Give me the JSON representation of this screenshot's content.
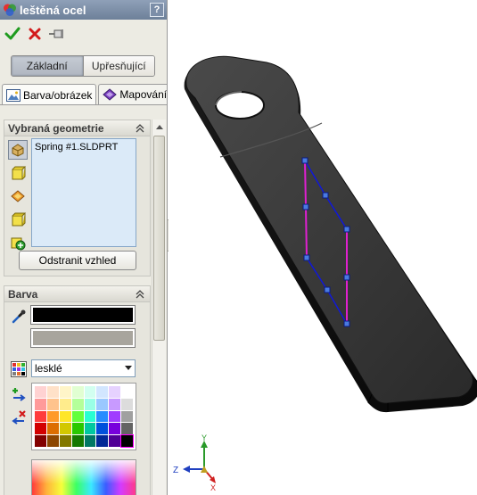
{
  "panel": {
    "title": "leštěná ocel",
    "help_label": "?",
    "mode_tabs": [
      {
        "label": "Základní",
        "active": true
      },
      {
        "label": "Upřesňující",
        "active": false
      }
    ],
    "tabs": [
      {
        "label": "Barva/obrázek",
        "icon": "image-icon",
        "active": true
      },
      {
        "label": "Mapování",
        "icon": "mapping-icon",
        "active": false
      }
    ],
    "geometry": {
      "title": "Vybraná geometrie",
      "items": [
        "Spring #1.SLDPRT"
      ],
      "filter_icons": [
        "select-part-icon",
        "select-body-icon",
        "select-face-icon",
        "select-feature-icon",
        "select-component-icon"
      ],
      "remove_button": "Odstranit vzhled"
    },
    "color": {
      "title": "Barva",
      "primary_color": "#000000",
      "secondary_color": "#a8a59d",
      "finish": "lesklé",
      "palette": [
        "#ffd2d2",
        "#ffe1c8",
        "#fff5c8",
        "#e1ffd2",
        "#d2fff0",
        "#d2e6ff",
        "#e6d2ff",
        "#ffffff",
        "#ff9a9a",
        "#ffc38c",
        "#ffec8c",
        "#b4ff9a",
        "#9affe6",
        "#9ac8ff",
        "#c89aff",
        "#dcdcdc",
        "#ff3c3c",
        "#ff9a28",
        "#ffe628",
        "#64ff3c",
        "#28ffd2",
        "#288cff",
        "#a03cff",
        "#a0a0a0",
        "#d20000",
        "#dc6e00",
        "#d2c800",
        "#28c800",
        "#00c8a0",
        "#0050dc",
        "#7800dc",
        "#646464",
        "#820000",
        "#8c4600",
        "#827800",
        "#147800",
        "#007864",
        "#002896",
        "#500096",
        "#000000"
      ]
    }
  },
  "viewport": {
    "axis_labels": {
      "x": "X",
      "y": "Y",
      "z": "Z"
    }
  }
}
